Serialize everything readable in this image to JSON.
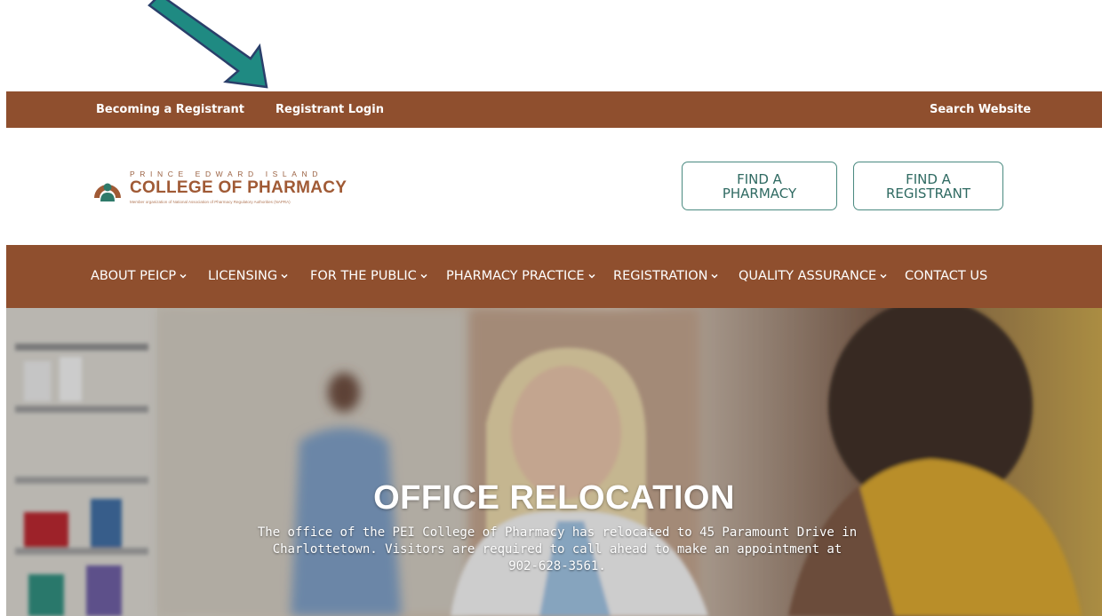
{
  "topbar": {
    "becoming_registrant": "Becoming a Registrant",
    "registrant_login": "Registrant Login",
    "search_website": "Search Website"
  },
  "logo": {
    "line1": "PRINCE EDWARD ISLAND",
    "line2": "COLLEGE OF PHARMACY",
    "line3": "Member organization of National Association of Pharmacy Regulatory Authorities (NAPRA)"
  },
  "buttons": {
    "find_pharmacy_l1": "FIND A",
    "find_pharmacy_l2": "PHARMACY",
    "find_registrant_l1": "FIND A",
    "find_registrant_l2": "REGISTRANT"
  },
  "nav": {
    "items": [
      {
        "label": "ABOUT PEICP",
        "dropdown": true
      },
      {
        "label": "LICENSING",
        "dropdown": true
      },
      {
        "label": "FOR THE PUBLIC",
        "dropdown": true
      },
      {
        "label": "PHARMACY PRACTICE",
        "dropdown": true
      },
      {
        "label": "REGISTRATION",
        "dropdown": true
      },
      {
        "label": "QUALITY ASSURANCE",
        "dropdown": true
      },
      {
        "label": "CONTACT US",
        "dropdown": false
      }
    ]
  },
  "hero": {
    "title": "OFFICE RELOCATION",
    "line1": "The office of the PEI College of Pharmacy has relocated to 45 Paramount Drive in",
    "line2": "Charlottetown. Visitors are required to call ahead to make an appointment at",
    "line3": "902-628-3561."
  },
  "colors": {
    "brand_brown": "#8f4f2e",
    "button_teal": "#4a8a80",
    "annotation_arrow": "#1f8a82"
  },
  "icons": {
    "dropdown": "chevron-down-icon",
    "annotation": "arrow-annotation-icon"
  }
}
